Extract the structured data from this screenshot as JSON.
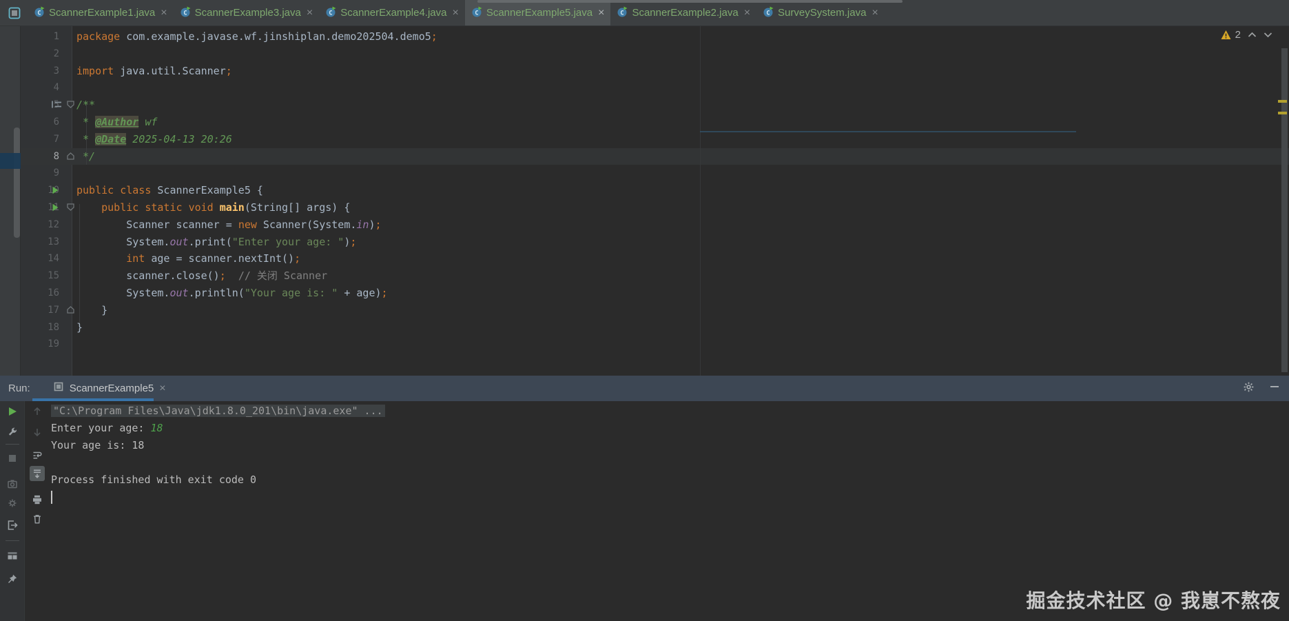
{
  "colors": {
    "tab_text": "#7fa96f",
    "keyword": "#cc7832",
    "string": "#6a8759",
    "doc_comment": "#629755",
    "warning": "#d8a827",
    "run_tab_underline": "#3873a8",
    "console_input": "#4ea14b",
    "selection_blue": "#1a3a55",
    "editor_bg": "#2b2b2b"
  },
  "tabbar": {
    "tabs": [
      {
        "label": "ScannerExample1.java",
        "active": false
      },
      {
        "label": "ScannerExample3.java",
        "active": false
      },
      {
        "label": "ScannerExample4.java",
        "active": false
      },
      {
        "label": "ScannerExample5.java",
        "active": true
      },
      {
        "label": "ScannerExample2.java",
        "active": false
      },
      {
        "label": "SurveySystem.java",
        "active": false
      }
    ]
  },
  "editor": {
    "current_line": 8,
    "warning": {
      "count": "2"
    },
    "gutter": {
      "comment_line": 5,
      "run_lines": [
        10,
        11
      ],
      "fold_open": [
        5,
        11
      ],
      "fold_close": [
        8,
        17
      ]
    },
    "lines": [
      {
        "n": 1,
        "tokens": [
          [
            "kw",
            "package"
          ],
          [
            "pl",
            " com.example.javase.wf.jinshiplan.demo202504.demo5"
          ],
          [
            "semi",
            ";"
          ]
        ]
      },
      {
        "n": 2,
        "tokens": []
      },
      {
        "n": 3,
        "tokens": [
          [
            "kw",
            "import"
          ],
          [
            "pl",
            " java.util.Scanner"
          ],
          [
            "semi",
            ";"
          ]
        ]
      },
      {
        "n": 4,
        "tokens": []
      },
      {
        "n": 5,
        "tokens": [
          [
            "doc",
            "/**"
          ]
        ]
      },
      {
        "n": 6,
        "tokens": [
          [
            "doc",
            " * "
          ],
          [
            "doctag",
            "@Author"
          ],
          [
            "docval",
            " wf"
          ]
        ]
      },
      {
        "n": 7,
        "tokens": [
          [
            "doc",
            " * "
          ],
          [
            "doctag",
            "@Date"
          ],
          [
            "docval",
            " 2025-04-13 20:26"
          ]
        ]
      },
      {
        "n": 8,
        "tokens": [
          [
            "doc",
            " */"
          ]
        ]
      },
      {
        "n": 9,
        "tokens": []
      },
      {
        "n": 10,
        "tokens": [
          [
            "kw",
            "public"
          ],
          [
            "pl",
            " "
          ],
          [
            "kw",
            "class"
          ],
          [
            "pl",
            " ScannerExample5 {"
          ]
        ]
      },
      {
        "n": 11,
        "tokens": [
          [
            "pl",
            "    "
          ],
          [
            "kw",
            "public"
          ],
          [
            "pl",
            " "
          ],
          [
            "kw",
            "static"
          ],
          [
            "pl",
            " "
          ],
          [
            "kw",
            "void"
          ],
          [
            "pl",
            " "
          ],
          [
            "decl",
            "main"
          ],
          [
            "pl",
            "(String[] args) {"
          ]
        ]
      },
      {
        "n": 12,
        "tokens": [
          [
            "pl",
            "        Scanner scanner = "
          ],
          [
            "kw",
            "new"
          ],
          [
            "pl",
            " Scanner(System."
          ],
          [
            "field",
            "in"
          ],
          [
            "pl",
            ")"
          ],
          [
            "semi",
            ";"
          ]
        ]
      },
      {
        "n": 13,
        "tokens": [
          [
            "pl",
            "        System."
          ],
          [
            "field",
            "out"
          ],
          [
            "pl",
            ".print("
          ],
          [
            "str",
            "\"Enter your age: \""
          ],
          [
            "pl",
            ")"
          ],
          [
            "semi",
            ";"
          ]
        ]
      },
      {
        "n": 14,
        "tokens": [
          [
            "pl",
            "        "
          ],
          [
            "kw",
            "int"
          ],
          [
            "pl",
            " age = scanner.nextInt()"
          ],
          [
            "semi",
            ";"
          ]
        ]
      },
      {
        "n": 15,
        "tokens": [
          [
            "pl",
            "        scanner.close()"
          ],
          [
            "semi",
            ";"
          ],
          [
            "pl",
            "  "
          ],
          [
            "cmt",
            "// 关闭 Scanner"
          ]
        ]
      },
      {
        "n": 16,
        "tokens": [
          [
            "pl",
            "        System."
          ],
          [
            "field",
            "out"
          ],
          [
            "pl",
            ".println("
          ],
          [
            "str",
            "\"Your age is: \""
          ],
          [
            "pl",
            " + age)"
          ],
          [
            "semi",
            ";"
          ]
        ]
      },
      {
        "n": 17,
        "tokens": [
          [
            "pl",
            "    }"
          ]
        ]
      },
      {
        "n": 18,
        "tokens": [
          [
            "pl",
            "}"
          ]
        ]
      },
      {
        "n": 19,
        "tokens": []
      }
    ]
  },
  "run_panel": {
    "label": "Run:",
    "tab_label": "ScannerExample5",
    "toolbar_run": [
      {
        "icon": "rerun"
      },
      {
        "icon": "settings-wrench"
      },
      {
        "divider": true
      },
      {
        "icon": "stop",
        "disabled": true
      },
      {
        "icon": "dump-camera",
        "disabled": true
      },
      {
        "icon": "coverage-gear",
        "disabled": true
      },
      {
        "icon": "exit"
      },
      {
        "divider": true
      },
      {
        "icon": "restore-layout"
      },
      {
        "icon": "pin"
      }
    ],
    "toolbar_console": [
      {
        "icon": "up-stacktrace",
        "disabled": true
      },
      {
        "icon": "down-stacktrace",
        "disabled": true
      },
      {
        "icon": "soft-wrap"
      },
      {
        "icon": "scroll-to-end",
        "selected": true
      },
      {
        "icon": "print"
      },
      {
        "icon": "clear-all"
      }
    ],
    "console": [
      {
        "cls": "cmd",
        "parts": [
          [
            "cmd",
            "\"C:\\Program Files\\Java\\jdk1.8.0_201\\bin\\java.exe\" ..."
          ]
        ]
      },
      {
        "parts": [
          [
            "out",
            "Enter your age: "
          ],
          [
            "input",
            "18"
          ]
        ]
      },
      {
        "parts": [
          [
            "out",
            "Your age is: 18"
          ]
        ]
      },
      {
        "parts": []
      },
      {
        "parts": [
          [
            "out",
            "Process finished with exit code 0"
          ]
        ]
      },
      {
        "caret": true,
        "parts": []
      }
    ]
  },
  "watermark": "掘金技术社区 @ 我崽不熬夜"
}
